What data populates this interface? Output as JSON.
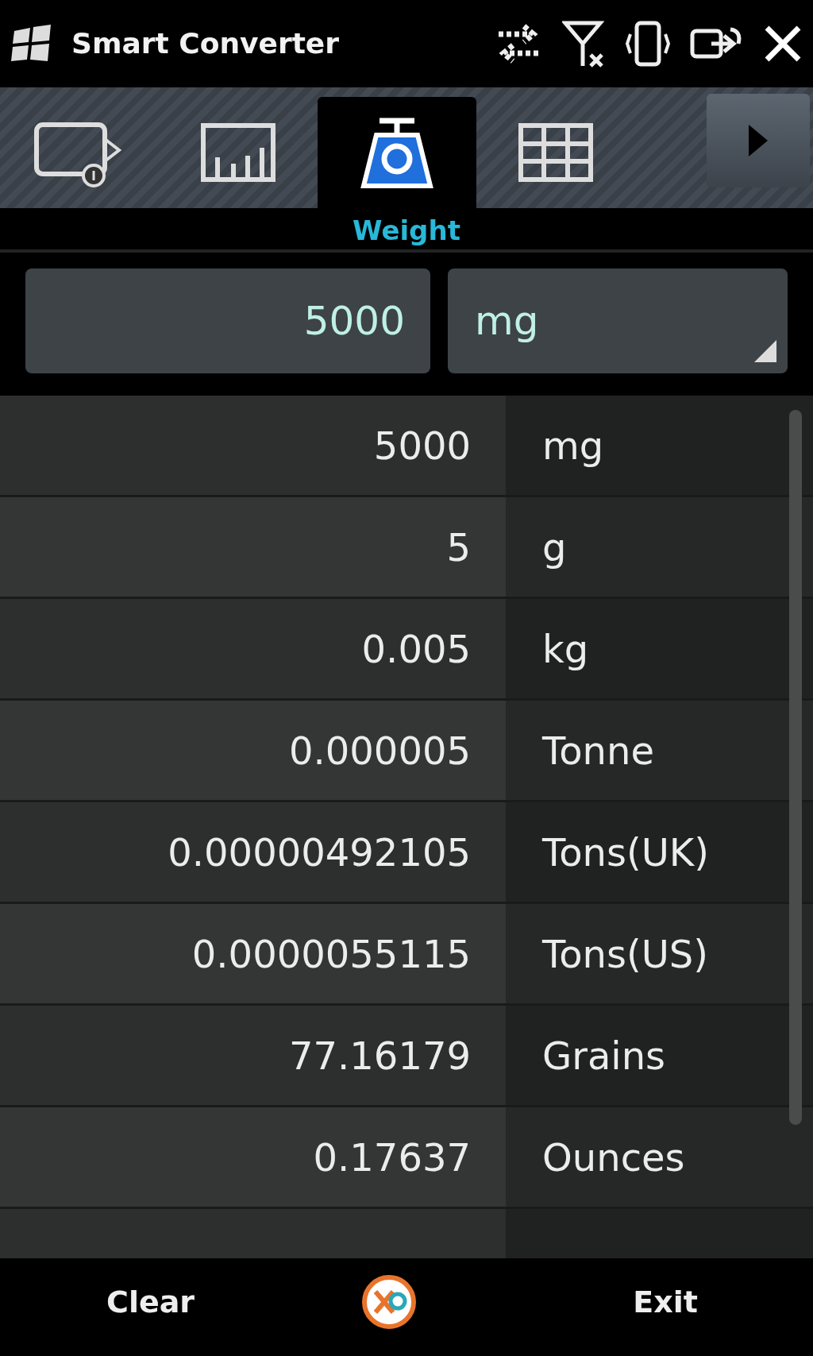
{
  "window": {
    "title": "Smart Converter"
  },
  "tabs": [
    {
      "kind": "device",
      "selected": false
    },
    {
      "kind": "chart",
      "selected": false
    },
    {
      "kind": "scale",
      "selected": true
    },
    {
      "kind": "grid",
      "selected": false
    }
  ],
  "tab_label": "Weight",
  "input": {
    "value": "5000",
    "unit": "mg"
  },
  "rows": [
    {
      "value": "5000",
      "unit": "mg"
    },
    {
      "value": "5",
      "unit": "g"
    },
    {
      "value": "0.005",
      "unit": "kg"
    },
    {
      "value": "0.000005",
      "unit": "Tonne"
    },
    {
      "value": "0.00000492105",
      "unit": "Tons(UK)"
    },
    {
      "value": "0.0000055115",
      "unit": "Tons(US)"
    },
    {
      "value": "77.16179",
      "unit": "Grains"
    },
    {
      "value": "0.17637",
      "unit": "Ounces"
    }
  ],
  "softkeys": {
    "left": "Clear",
    "right": "Exit"
  }
}
